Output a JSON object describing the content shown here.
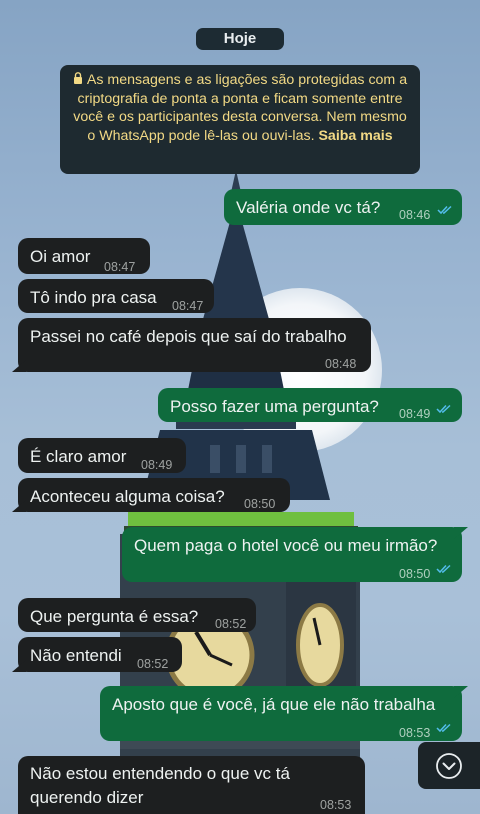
{
  "chat": {
    "day_label": "Hoje",
    "encryption_notice": "As mensagens e as ligações são protegidas com a criptografia de ponta a ponta e ficam somente entre você e os participantes desta conversa. Nem mesmo o WhatsApp pode lê-las ou ouvi-las.",
    "learn_more": "Saiba mais",
    "messages": [
      {
        "dir": "out",
        "text": "Valéria onde vc tá?",
        "time": "08:46",
        "status": "read"
      },
      {
        "dir": "in",
        "text": "Oi amor",
        "time": "08:47"
      },
      {
        "dir": "in",
        "text": "Tô indo pra casa",
        "time": "08:47"
      },
      {
        "dir": "in",
        "text": "Passei no café depois que saí do trabalho",
        "time": "08:48"
      },
      {
        "dir": "out",
        "text": "Posso fazer uma pergunta?",
        "time": "08:49",
        "status": "read"
      },
      {
        "dir": "in",
        "text": "É claro amor",
        "time": "08:49"
      },
      {
        "dir": "in",
        "text": "Aconteceu alguma coisa?",
        "time": "08:50"
      },
      {
        "dir": "out",
        "text": "Quem paga o hotel você ou meu irmão?",
        "time": "08:50",
        "status": "read"
      },
      {
        "dir": "in",
        "text": "Que pergunta é essa?",
        "time": "08:52"
      },
      {
        "dir": "in",
        "text": "Não entendi",
        "time": "08:52"
      },
      {
        "dir": "out",
        "text": "Aposto que é você, já que ele não trabalha",
        "time": "08:53",
        "status": "read"
      },
      {
        "dir": "in",
        "text": "Não estou entendendo o que vc tá querendo dizer",
        "time": "08:53"
      }
    ]
  },
  "scroll_down_icon": "chevron-down-circle-icon",
  "colors": {
    "incoming_bubble": "#1d1f20",
    "outgoing_bubble": "#0f6b3d",
    "notice_text": "#f2d985",
    "read_ticks": "#53bdeb"
  }
}
